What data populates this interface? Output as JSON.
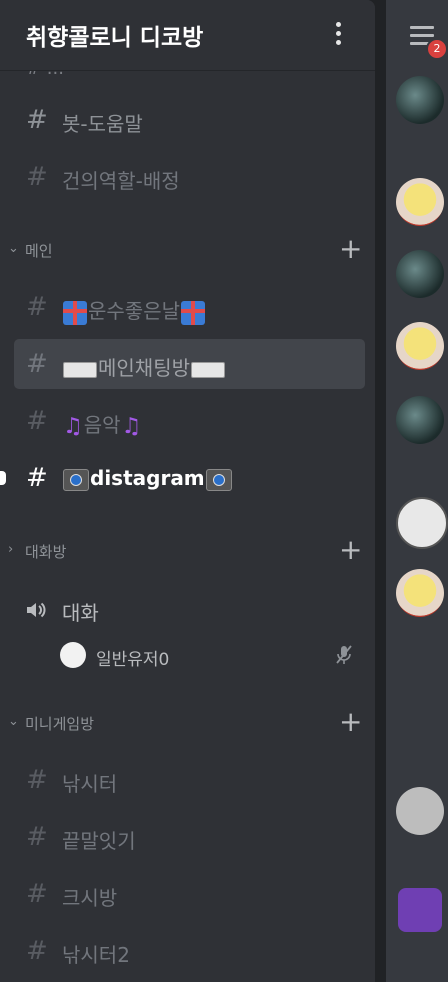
{
  "server": {
    "name": "취향콜로니 디코방",
    "more_icon": "more-vertical-icon"
  },
  "cut_channel": "# ...",
  "top_channels": [
    {
      "label": "봇-도움말"
    },
    {
      "label": "건의역할-배정"
    }
  ],
  "categories": [
    {
      "label": "메인",
      "collapsed": false
    },
    {
      "label": "대화방",
      "collapsed": true
    },
    {
      "label": "미니게임방",
      "collapsed": false
    }
  ],
  "main_channels": [
    {
      "label": "운수좋은날"
    },
    {
      "label": "메인채팅방"
    },
    {
      "label": "음악"
    },
    {
      "label": "distagram"
    }
  ],
  "voice": {
    "channel": "대화",
    "user": "일반유저0"
  },
  "game_channels": [
    {
      "label": "낚시터"
    },
    {
      "label": "끝말잇기"
    },
    {
      "label": "크시방"
    },
    {
      "label": "낚시터2"
    }
  ],
  "right": {
    "badge_count": "2"
  },
  "colors": {
    "background": "#2f3136",
    "selected": "#42454b",
    "badge": "#d9413f"
  }
}
